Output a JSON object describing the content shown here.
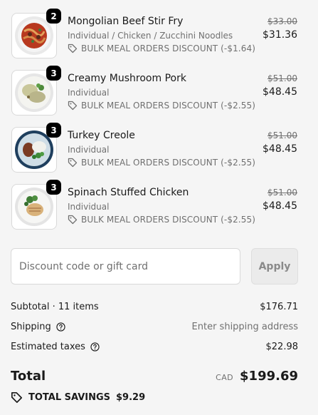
{
  "items": [
    {
      "name": "Mongolian Beef Stir Fry",
      "quantity": "2",
      "variant": "Individual / Chicken / Zucchini Noodles",
      "discount": "BULK MEAL ORDERS DISCOUNT (-$1.64)",
      "price_original": "$33.00",
      "price_final": "$31.36"
    },
    {
      "name": "Creamy Mushroom Pork",
      "quantity": "3",
      "variant": "Individual",
      "discount": "BULK MEAL ORDERS DISCOUNT (-$2.55)",
      "price_original": "$51.00",
      "price_final": "$48.45"
    },
    {
      "name": "Turkey Creole",
      "quantity": "3",
      "variant": "Individual",
      "discount": "BULK MEAL ORDERS DISCOUNT (-$2.55)",
      "price_original": "$51.00",
      "price_final": "$48.45"
    },
    {
      "name": "Spinach Stuffed Chicken",
      "quantity": "3",
      "variant": "Individual",
      "discount": "BULK MEAL ORDERS DISCOUNT (-$2.55)",
      "price_original": "$51.00",
      "price_final": "$48.45"
    }
  ],
  "discount": {
    "placeholder": "Discount code or gift card",
    "value": "",
    "apply_label": "Apply"
  },
  "summary": {
    "subtotal_label": "Subtotal · 11 items",
    "subtotal_value": "$176.71",
    "shipping_label": "Shipping",
    "shipping_value": "Enter shipping address",
    "taxes_label": "Estimated taxes",
    "taxes_value": "$22.98"
  },
  "total": {
    "label": "Total",
    "currency": "CAD",
    "value": "$199.69"
  },
  "savings": {
    "label": "TOTAL SAVINGS",
    "value": "$9.29"
  },
  "icons": {
    "tag": "tag-icon",
    "help": "help-icon"
  },
  "colors": {
    "background": "#f5f5f5",
    "text": "#1a1a1a",
    "muted": "#707070",
    "badge": "#000000"
  }
}
